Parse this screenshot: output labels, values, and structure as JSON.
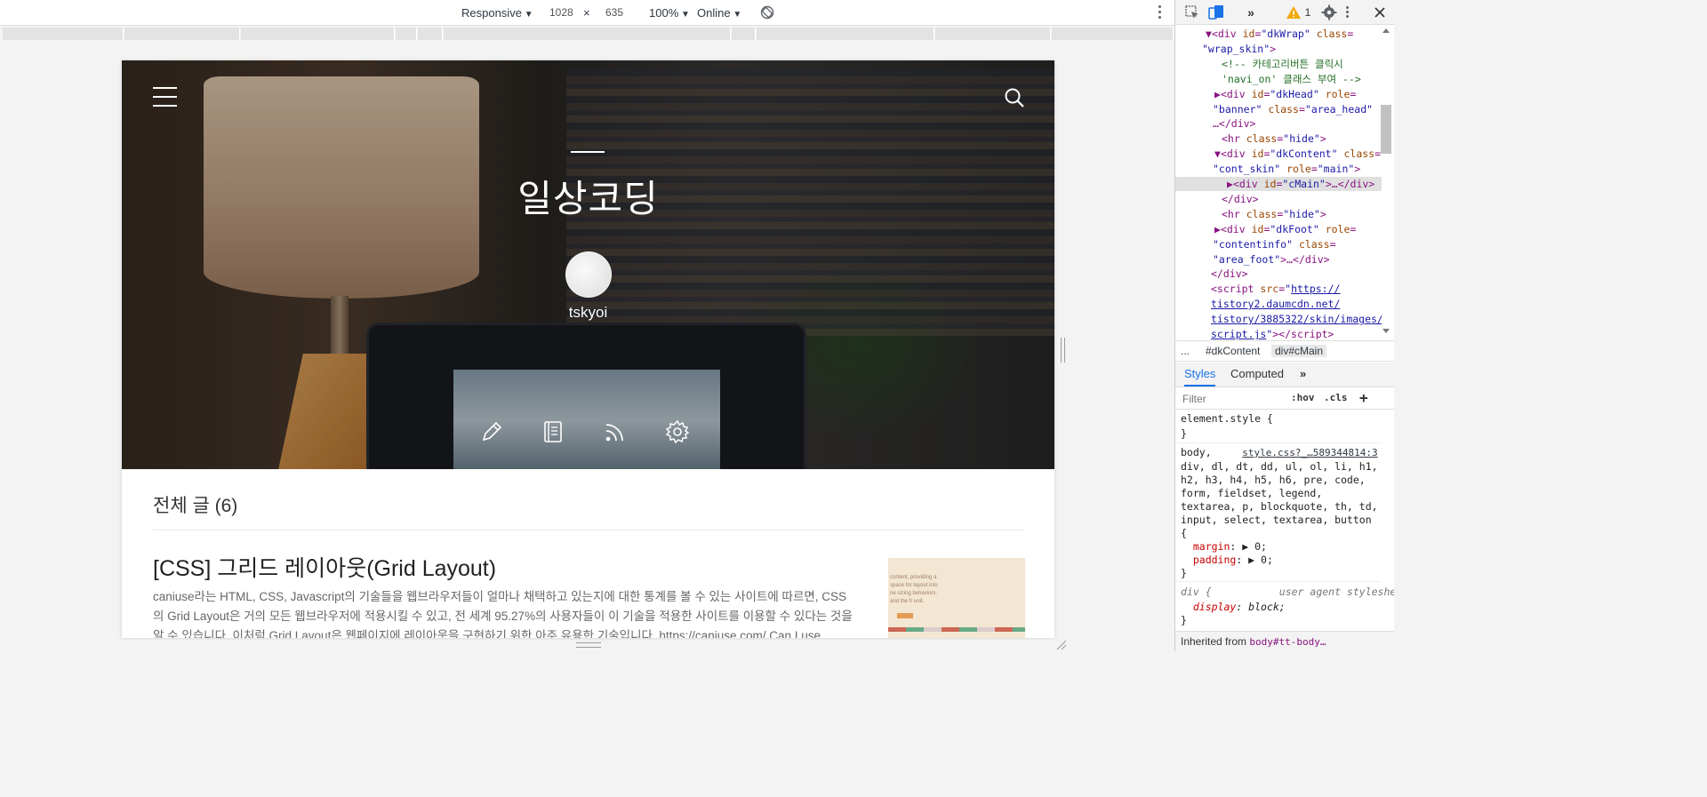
{
  "device_toolbar": {
    "device": "Responsive",
    "width": "1028",
    "times": "×",
    "height": "635",
    "zoom": "100%",
    "throttle": "Online"
  },
  "blog": {
    "title": "일상코딩",
    "blogger": "tskyoi",
    "category": "전체 글 (6)",
    "post_title": "[CSS] 그리드 레이아웃(Grid Layout)",
    "post_summary": "caniuse라는 HTML, CSS, Javascript의 기술들을 웹브라우저들이 얼마나 채택하고 있는지에 대한 통계를 볼 수 있는 사이트에 따르면, CSS의 Grid Layout은 거의 모든 웹브라우저에 적용시킬 수 있고, 전 세계 95.27%의 사용자들이 이 기술을 적용한 사이트를 이용할 수 있다는 것을 알 수 있습니다. 이처럼 Grid Layout은 웹페이지에 레이아웃을 구현하기 위한 아주 유용한 기술입니다. https://caniuse.com/ Can I use... Support table",
    "thumb_text": "content, providing a\nspace for layout into\nne sizing behaviors.\nand the fr unit.",
    "actions": [
      "pencil-icon",
      "notebook-icon",
      "rss-icon",
      "gear-icon"
    ]
  },
  "devtools": {
    "warn_count": "1",
    "dom_lines": [
      {
        "html": "▼<span class='tag'>&lt;div</span> <span class='attr'>id</span>=<span class='val'>\"dkWrap\"</span> <span class='attr'>class</span>="
      },
      {
        "html": "<span class='val'>\"wrap_skin\"</span><span class='tag'>&gt;</span>"
      },
      {
        "html": "<span class='cmt'>&lt;!-- 카테고리버튼 클릭시</span>"
      },
      {
        "html": "<span class='cmt'>'navi_on' 클래스 부여 --&gt;</span>"
      },
      {
        "html": "▶<span class='tag'>&lt;div</span> <span class='attr'>id</span>=<span class='val'>\"dkHead\"</span> <span class='attr'>role</span>="
      },
      {
        "html": "<span class='val'>\"banner\"</span> <span class='attr'>class</span>=<span class='val'>\"area_head\"</span>"
      },
      {
        "html": "<span class='tag'>…&lt;/div&gt;</span>"
      },
      {
        "html": "<span class='tag'>&lt;hr</span> <span class='attr'>class</span>=<span class='val'>\"hide\"</span><span class='tag'>&gt;</span>"
      },
      {
        "html": "▼<span class='tag'>&lt;div</span> <span class='attr'>id</span>=<span class='val'>\"dkContent\"</span> <span class='attr'>class</span>="
      },
      {
        "html": "<span class='val'>\"cont_skin\"</span> <span class='attr'>role</span>=<span class='val'>\"main\"</span><span class='tag'>&gt;</span>"
      },
      {
        "html": "▶<span class='tag'>&lt;div</span> <span class='attr'>id</span>=<span class='val'>\"cMain\"</span><span class='tag'>&gt;…&lt;/div&gt;</span>"
      },
      {
        "html": "<span class='tag'>&lt;/div&gt;</span>"
      },
      {
        "html": "<span class='tag'>&lt;hr</span> <span class='attr'>class</span>=<span class='val'>\"hide\"</span><span class='tag'>&gt;</span>"
      },
      {
        "html": "▶<span class='tag'>&lt;div</span> <span class='attr'>id</span>=<span class='val'>\"dkFoot\"</span> <span class='attr'>role</span>="
      },
      {
        "html": "<span class='val'>\"contentinfo\"</span> <span class='attr'>class</span>="
      },
      {
        "html": "<span class='val'>\"area_foot\"</span><span class='tag'>&gt;…&lt;/div&gt;</span>"
      },
      {
        "html": "<span class='tag'>&lt;/div&gt;</span>"
      },
      {
        "html": "<span class='tag'>&lt;script</span> <span class='attr'>src</span>=<span class='val'>\"</span><span class='lnk'>https://</span>"
      },
      {
        "html": "<span class='lnk'>tistory2.daumcdn.net/</span>"
      },
      {
        "html": "<span class='lnk'>tistory/3885322/skin/images/</span>"
      },
      {
        "html": "<span class='lnk'>script.js</span><span class='val'>\"</span><span class='tag'>&gt;&lt;/script&gt;</span>"
      }
    ],
    "crumbs": [
      "...",
      "#dkContent",
      "div#cMain"
    ],
    "tabs": [
      "Styles",
      "Computed"
    ],
    "filter_placeholder": "Filter",
    "hov": ":hov",
    "cls": ".cls",
    "style_lines": [
      {
        "html": "element.style {"
      },
      {
        "html": "}"
      },
      {
        "html": "body,     <span class='src'>style.css?_…589344814:3</span>"
      },
      {
        "html": "div, dl, dt, dd, ul, ol, li, h1,"
      },
      {
        "html": "h2, h3, h4, h5, h6, pre, code,"
      },
      {
        "html": "form, fieldset, legend,"
      },
      {
        "html": "textarea, p, blockquote, th, td,"
      },
      {
        "html": "input, select, textarea, button"
      },
      {
        "html": "{"
      },
      {
        "html": "  <span class='prop'>margin</span>: ▶ 0;"
      },
      {
        "html": "  <span class='prop'>padding</span>: ▶ 0;"
      },
      {
        "html": "}"
      },
      {
        "html": "<span class='ua'>div {           user agent stylesheet</span>"
      },
      {
        "html": "  <span class='prop'><i>display</i></span><i>: block;</i>"
      },
      {
        "html": "}"
      }
    ],
    "inherited_label": "Inherited from",
    "inherited_selector": "body#tt-body…"
  }
}
